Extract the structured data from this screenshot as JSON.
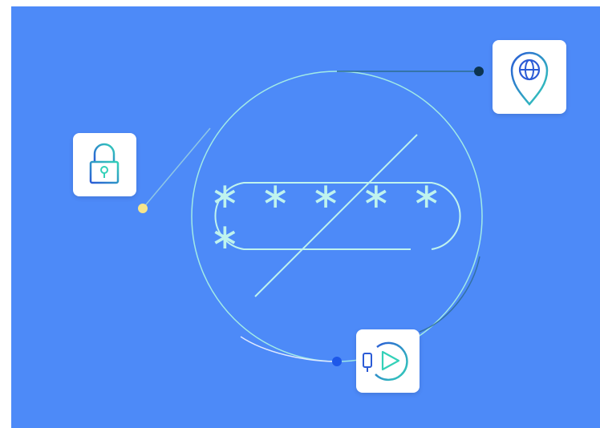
{
  "colors": {
    "background": "#4d8af8",
    "line_light": "#a7f0e6",
    "icon_teal": "#33d1b8",
    "icon_blue": "#2b5bd6",
    "dot_yellow": "#f6e58b",
    "dot_navy": "#0c3451",
    "dot_blue": "#1d58e9"
  },
  "password_mask": "∗ ∗ ∗ ∗ ∗ ∗",
  "icons": {
    "lock": "lock-icon",
    "location": "location-globe-icon",
    "player": "mobile-play-icon"
  }
}
